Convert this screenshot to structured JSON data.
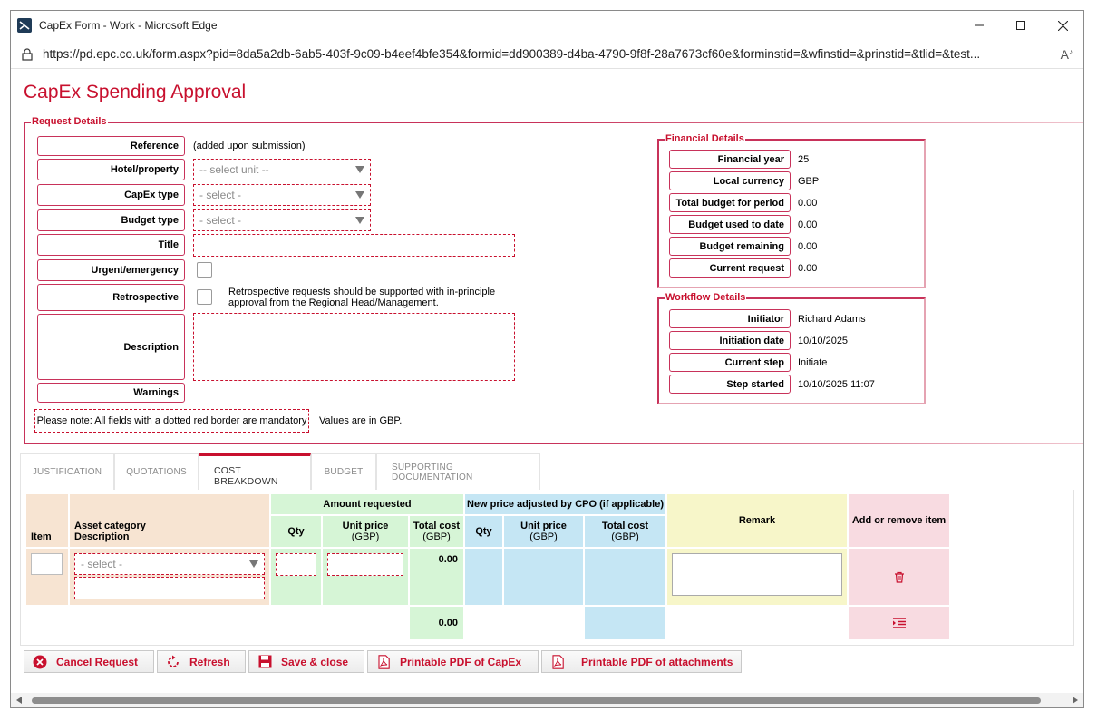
{
  "window": {
    "title": "CapEx Form - Work - Microsoft Edge",
    "url": "https://pd.epc.co.uk/form.aspx?pid=8da5a2db-6ab5-403f-9c09-b4eef4bfe354&formid=dd900389-d4ba-4790-9f8f-28a7673cf60e&forminstid=&wfinstid=&prinstid=&tlid=&test..."
  },
  "page": {
    "title": "CapEx Spending Approval"
  },
  "request_details": {
    "legend": "Request Details",
    "reference_label": "Reference",
    "reference_value": "(added upon submission)",
    "hotel_label": "Hotel/property",
    "hotel_placeholder": "-- select unit --",
    "capex_type_label": "CapEx type",
    "capex_type_placeholder": "- select -",
    "budget_type_label": "Budget type",
    "budget_type_placeholder": "- select -",
    "title_label": "Title",
    "title_value": "",
    "urgent_label": "Urgent/emergency",
    "retrospective_label": "Retrospective",
    "retrospective_note_1": "Retrospective requests should be supported with in-principle",
    "retrospective_note_2": "approval from the Regional Head/Management.",
    "description_label": "Description",
    "description_value": "",
    "warnings_label": "Warnings",
    "mandatory_note": "Please note: All fields with a dotted red border are mandatory",
    "values_note": "Values are in GBP."
  },
  "financial_details": {
    "legend": "Financial Details",
    "rows": [
      {
        "label": "Financial year",
        "value": "25"
      },
      {
        "label": "Local currency",
        "value": "GBP"
      },
      {
        "label": "Total budget for period",
        "value": "0.00"
      },
      {
        "label": "Budget used to date",
        "value": "0.00"
      },
      {
        "label": "Budget remaining",
        "value": "0.00"
      },
      {
        "label": "Current request",
        "value": "0.00"
      }
    ]
  },
  "workflow_details": {
    "legend": "Workflow Details",
    "rows": [
      {
        "label": "Initiator",
        "value": "Richard Adams"
      },
      {
        "label": "Initiation date",
        "value": "10/10/2025"
      },
      {
        "label": "Current step",
        "value": "Initiate"
      },
      {
        "label": "Step started",
        "value": "10/10/2025 11:07"
      }
    ]
  },
  "tabs": [
    {
      "label": "JUSTIFICATION",
      "active": false
    },
    {
      "label": "QUOTATIONS",
      "active": false
    },
    {
      "label": "COST BREAKDOWN",
      "active": true
    },
    {
      "label": "BUDGET",
      "active": false
    },
    {
      "label": "SUPPORTING DOCUMENTATION",
      "active": false
    }
  ],
  "cost_table": {
    "item_header": "Item",
    "asset_header_1": "Asset category",
    "asset_header_2": "Description",
    "amount_requested_header": "Amount requested",
    "cpo_header": "New price adjusted by CPO (if applicable)",
    "qty_header": "Qty",
    "unit_price_header_1": "Unit price",
    "unit_price_header_2": "(GBP)",
    "total_cost_header_1": "Total cost",
    "total_cost_header_2": "(GBP)",
    "remark_header": "Remark",
    "add_remove_header": "Add or remove item",
    "asset_placeholder": "- select -",
    "row_total": "0.00",
    "grand_total": "0.00"
  },
  "buttons": {
    "cancel": "Cancel Request",
    "refresh": "Refresh",
    "save_close": "Save & close",
    "pdf_capex": "Printable PDF of CapEx",
    "pdf_attachments": "Printable PDF of attachments"
  },
  "colors": {
    "brand": "#c8102e",
    "peach": "#f7e4d2",
    "green": "#d6f5d6",
    "blue": "#c5e6f4",
    "yellow": "#f7f6c9",
    "pink": "#f8dbe1"
  },
  "icons": {
    "trash": "trash-icon",
    "add_row": "add-row-icon",
    "cancel": "cancel-circle-icon",
    "refresh": "refresh-icon",
    "save": "floppy-disk-icon",
    "pdf": "pdf-icon"
  }
}
